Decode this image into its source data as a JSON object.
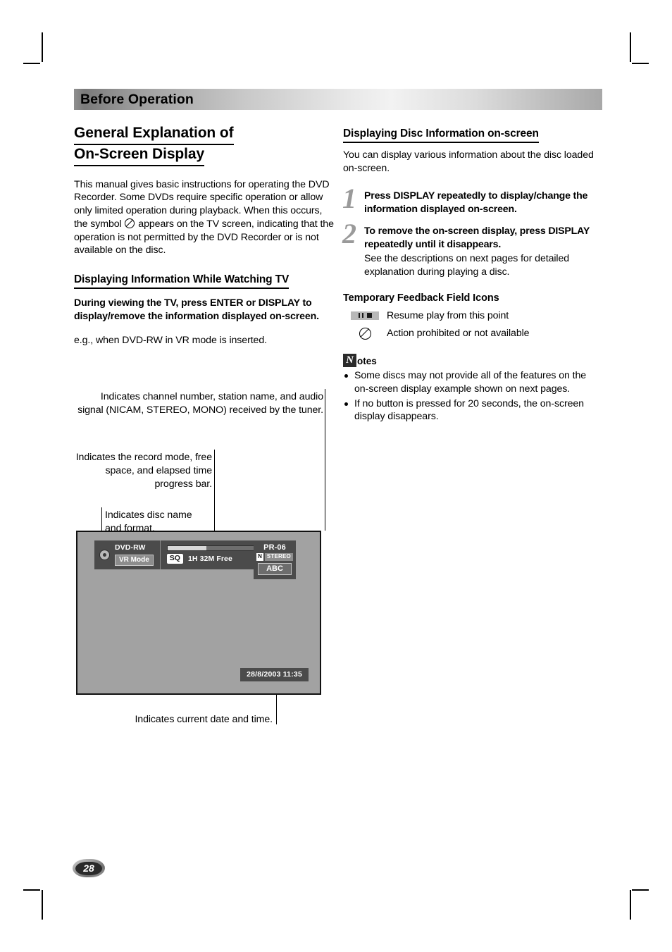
{
  "header": {
    "chapter": "Before Operation"
  },
  "left": {
    "section_title_line1": "General Explanation of",
    "section_title_line2": "On-Screen Display",
    "intro_part1": "This manual gives basic instructions for operating the DVD Recorder. Some DVDs require specific operation or allow only limited operation during playback. When this occurs, the symbol",
    "intro_part2": "appears on the TV screen, indicating that the operation is not permitted by the DVD Recorder or is not available on the disc.",
    "watching_tv_title": "Displaying Information While Watching TV",
    "watching_tv_bold": "During viewing the TV, press ENTER or DISPLAY to display/remove the information displayed on-screen.",
    "watching_tv_note": "e.g., when DVD-RW in VR mode is inserted.",
    "callouts": {
      "tuner": "Indicates channel number, station name, and audio signal (NICAM, STEREO, MONO) received by the tuner.",
      "record_mode": "Indicates the record mode, free space, and elapsed time progress bar.",
      "disc": "Indicates disc name and format.",
      "datetime": "Indicates current date and time."
    },
    "osd": {
      "disc_name": "DVD-RW",
      "disc_format": "VR Mode",
      "record_mode_badge": "SQ",
      "free_space": "1H 32M Free",
      "progress_percent": 45,
      "channel": "PR-06",
      "audio_system": "N",
      "audio_mode": "STEREO",
      "station_name": "ABC",
      "datetime": "28/8/2003  11:35"
    }
  },
  "right": {
    "disc_info_title": "Displaying Disc Information on-screen",
    "disc_info_body": "You can display various information about the disc loaded on-screen.",
    "steps": [
      {
        "number": "1",
        "lead": "Press DISPLAY repeatedly to display/change the information displayed on-screen.",
        "sub": ""
      },
      {
        "number": "2",
        "lead": "To remove the on-screen display, press DISPLAY repeatedly until it disappears.",
        "sub": "See the descriptions on next pages for detailed explanation during playing a disc."
      }
    ],
    "feedback_title": "Temporary Feedback Field Icons",
    "feedback_items": [
      {
        "icon": "resume-play-icon",
        "label": "Resume play from this point"
      },
      {
        "icon": "action-prohibited-icon",
        "label": "Action prohibited or not available"
      }
    ],
    "notes": {
      "n_glyph": "N",
      "word": "otes",
      "items": [
        "Some discs may not provide all of the features on the on-screen display example shown on next pages.",
        "If no button is pressed for 20 seconds, the on-screen display disappears."
      ]
    }
  },
  "footer": {
    "page_number": "28"
  }
}
